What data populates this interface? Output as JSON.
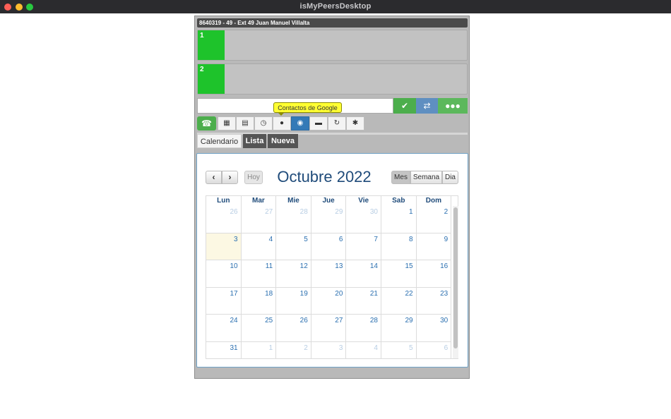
{
  "window": {
    "title": "isMyPeersDesktop"
  },
  "user_bar": {
    "text": "8640319 - 49 - Ext 49 Juan Manuel Villalta"
  },
  "lines": [
    {
      "label": "1"
    },
    {
      "label": "2"
    }
  ],
  "dial": {
    "input_value": "",
    "placeholder": ""
  },
  "tooltip": {
    "text": "Contactos de Google"
  },
  "toolbar": [
    {
      "icon": "dialpad-icon",
      "glyph": "▦"
    },
    {
      "icon": "agenda-icon",
      "glyph": "▤"
    },
    {
      "icon": "history-icon",
      "glyph": "◷"
    },
    {
      "icon": "contact-icon",
      "glyph": "●"
    },
    {
      "icon": "globe-icon",
      "glyph": "◉"
    },
    {
      "icon": "chat-icon",
      "glyph": "▬"
    },
    {
      "icon": "forward-icon",
      "glyph": "↻"
    },
    {
      "icon": "gear-icon",
      "glyph": "✱"
    }
  ],
  "tabs": {
    "calendar": "Calendario",
    "list": "Lista",
    "new": "Nueva"
  },
  "calendar": {
    "title": "Octubre 2022",
    "today_label": "Hoy",
    "prev": "‹",
    "next": "›",
    "views": {
      "month": "Mes",
      "week": "Semana",
      "day": "Dia"
    },
    "weekdays": [
      "Lun",
      "Mar",
      "Mie",
      "Jue",
      "Vie",
      "Sab",
      "Dom"
    ],
    "weeks": [
      [
        {
          "d": "26",
          "o": true
        },
        {
          "d": "27",
          "o": true
        },
        {
          "d": "28",
          "o": true
        },
        {
          "d": "29",
          "o": true
        },
        {
          "d": "30",
          "o": true
        },
        {
          "d": "1"
        },
        {
          "d": "2"
        }
      ],
      [
        {
          "d": "3",
          "t": true
        },
        {
          "d": "4"
        },
        {
          "d": "5"
        },
        {
          "d": "6"
        },
        {
          "d": "7"
        },
        {
          "d": "8"
        },
        {
          "d": "9"
        }
      ],
      [
        {
          "d": "10"
        },
        {
          "d": "11"
        },
        {
          "d": "12"
        },
        {
          "d": "13"
        },
        {
          "d": "14"
        },
        {
          "d": "15"
        },
        {
          "d": "16"
        }
      ],
      [
        {
          "d": "17"
        },
        {
          "d": "18"
        },
        {
          "d": "19"
        },
        {
          "d": "20"
        },
        {
          "d": "21"
        },
        {
          "d": "22"
        },
        {
          "d": "23"
        }
      ],
      [
        {
          "d": "24"
        },
        {
          "d": "25"
        },
        {
          "d": "26"
        },
        {
          "d": "27"
        },
        {
          "d": "28"
        },
        {
          "d": "29"
        },
        {
          "d": "30"
        }
      ],
      [
        {
          "d": "31"
        },
        {
          "d": "1",
          "o": true
        },
        {
          "d": "2",
          "o": true
        },
        {
          "d": "3",
          "o": true
        },
        {
          "d": "4",
          "o": true
        },
        {
          "d": "5",
          "o": true
        },
        {
          "d": "6",
          "o": true
        }
      ]
    ]
  }
}
